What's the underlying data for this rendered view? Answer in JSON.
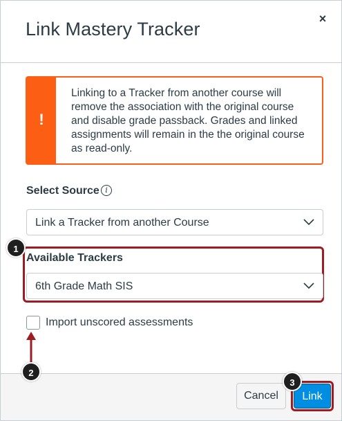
{
  "modal": {
    "title": "Link Mastery Tracker",
    "close_label": "×"
  },
  "alert": {
    "icon": "!",
    "text": "Linking to a Tracker from another course will remove the association with the original course and disable grade passback. Grades and linked assignments will remain in the the original course as read-only.",
    "color": "#fc5e13"
  },
  "source": {
    "label": "Select Source",
    "info_icon": "i",
    "selected": "Link a Tracker from another Course"
  },
  "trackers": {
    "label": "Available Trackers",
    "selected": "6th Grade Math SIS"
  },
  "import_option": {
    "label": "Import unscored assessments",
    "checked": false
  },
  "footer": {
    "cancel_label": "Cancel",
    "link_label": "Link"
  },
  "callouts": [
    "1",
    "2",
    "3"
  ],
  "colors": {
    "primary": "#008ee2",
    "highlight": "#9e1b22",
    "text": "#2d3b45"
  }
}
